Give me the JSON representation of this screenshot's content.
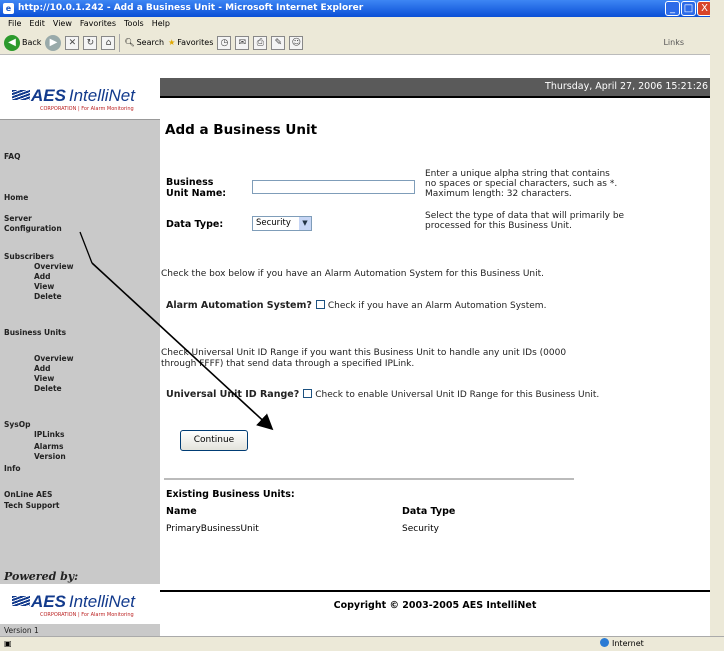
{
  "window": {
    "title": "http://10.0.1.242 - Add a Business Unit - Microsoft Internet Explorer",
    "controls": [
      "_",
      "□",
      "X"
    ]
  },
  "menu": [
    "File",
    "Edit",
    "View",
    "Favorites",
    "Tools",
    "Help"
  ],
  "toolbar": {
    "back": "Back",
    "search": "Search",
    "favorites": "Favorites",
    "links": "Links"
  },
  "header": {
    "datetime": "Thursday, April 27, 2006 15:21:26"
  },
  "logo": {
    "aes": "AES",
    "intellinet": "IntelliNet",
    "tagline": "CORPORATION | For Alarm Monitoring"
  },
  "sidebar": {
    "faq": "FAQ",
    "home": "Home",
    "server_config": [
      "Server",
      "Configuration"
    ],
    "subscribers": {
      "title": "Subscribers",
      "items": [
        "Overview",
        "Add",
        "View",
        "Delete"
      ]
    },
    "business_units": {
      "title": "Business Units",
      "items": [
        "Overview",
        "Add",
        "View",
        "Delete"
      ]
    },
    "sysop": {
      "title": "SysOp",
      "items": [
        "IPLinks",
        "Alarms",
        "Version"
      ]
    },
    "info": "Info",
    "online": [
      "OnLine AES",
      "Tech Support"
    ],
    "powered_by": "Powered by:",
    "version": "Version 1"
  },
  "main": {
    "title": "Add a Business Unit",
    "business_unit_label": [
      "Business",
      "Unit Name:"
    ],
    "business_unit_value": "",
    "business_unit_help": [
      "Enter a unique alpha string that contains",
      "no spaces or special characters, such as *.",
      "Maximum length: 32 characters."
    ],
    "data_type_label": "Data Type:",
    "data_type_value": "Security",
    "data_type_help": [
      "Select the type of data that will primarily be",
      "processed for this Business Unit."
    ],
    "alarm_intro": "Check the box below if you have an Alarm Automation System for this Business Unit.",
    "alarm_label": "Alarm Automation System?",
    "alarm_check_text": "Check if you have an Alarm Automation System.",
    "universal_intro": [
      "Check Universal Unit ID Range if you want this Business Unit to handle any unit IDs (0000",
      "through FFFF) that send data through a specified IPLink."
    ],
    "universal_label": "Universal Unit ID Range?",
    "universal_check_text": "Check to enable Universal Unit ID Range for this Business Unit.",
    "continue_label": "Continue",
    "existing_title": "Existing Business Units:",
    "columns": [
      "Name",
      "Data Type"
    ],
    "rows": [
      [
        "PrimaryBusinessUnit",
        "Security"
      ]
    ]
  },
  "footer": {
    "copyright": "Copyright © 2003-2005 AES IntelliNet"
  },
  "status": {
    "zone": "Internet"
  }
}
